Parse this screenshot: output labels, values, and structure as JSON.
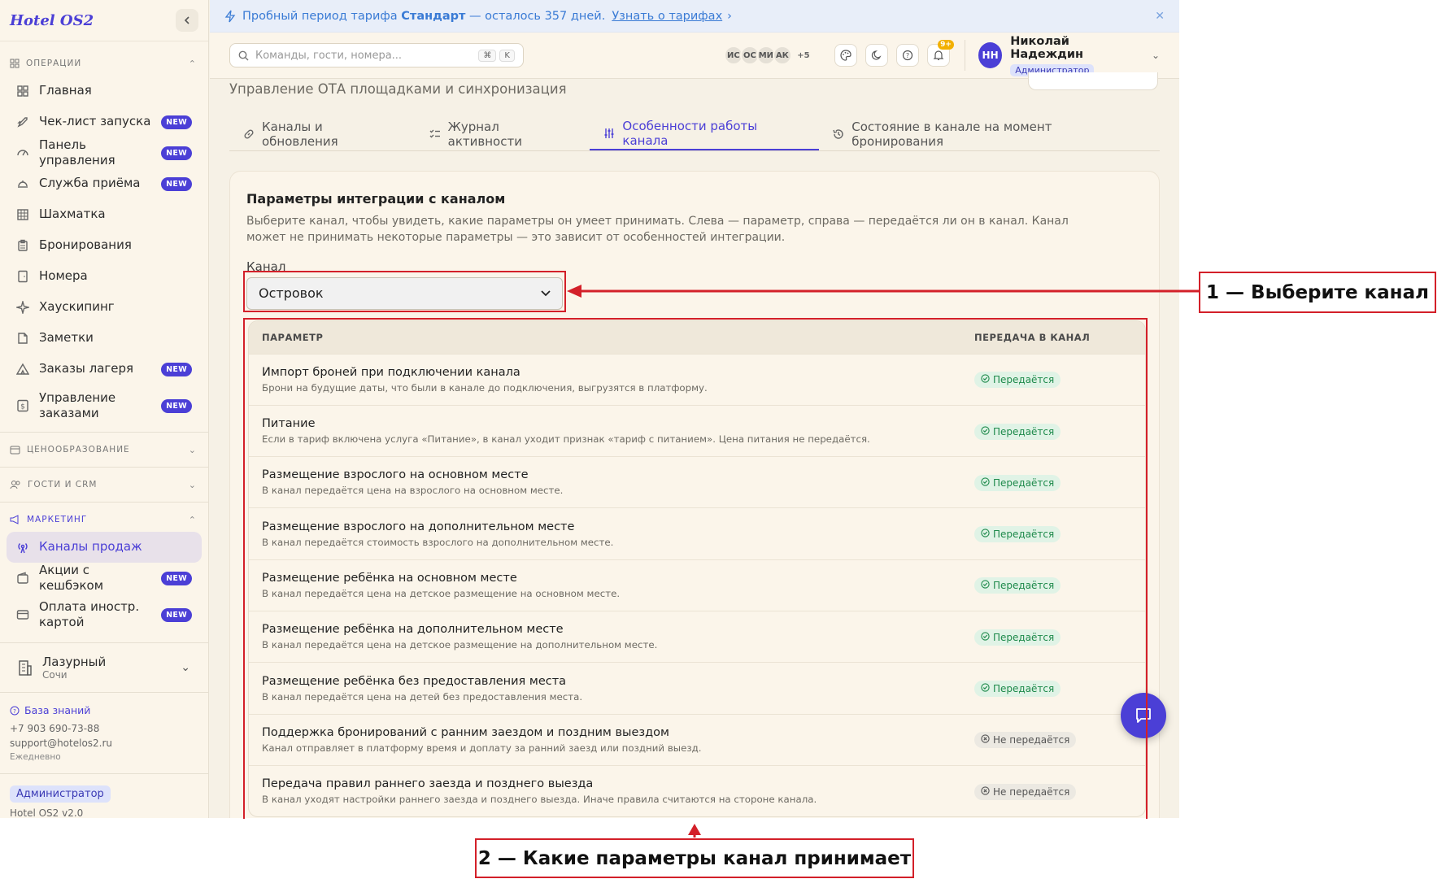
{
  "app": {
    "logo": "Hotel OS2"
  },
  "trial": {
    "prefix": "Пробный период тарифа",
    "plan": "Стандарт",
    "suffix": "— осталось 357 дней.",
    "link": "Узнать о тарифах"
  },
  "search": {
    "placeholder": "Команды, гости, номера...",
    "kbd1": "⌘",
    "kbd2": "K"
  },
  "avatars": [
    "ИС",
    "ОС",
    "МИ",
    "АК",
    "+5"
  ],
  "notifications": {
    "count": "9+"
  },
  "user": {
    "initials": "НН",
    "name": "Николай Надеждин",
    "role": "Администратор"
  },
  "sidebar": {
    "group_ops": "Операции",
    "group_pricing": "Ценообразование",
    "group_guests": "Гости и CRM",
    "group_marketing": "Маркетинг",
    "new_badge": "NEW",
    "items": [
      {
        "label": "Главная",
        "icon": "grid-icon"
      },
      {
        "label": "Чек-лист запуска",
        "icon": "rocket-icon",
        "new": true
      },
      {
        "label": "Панель управления",
        "icon": "gauge-icon",
        "new": true
      },
      {
        "label": "Служба приёма",
        "icon": "bell-service-icon",
        "new": true
      },
      {
        "label": "Шахматка",
        "icon": "table-icon"
      },
      {
        "label": "Бронирования",
        "icon": "clipboard-icon"
      },
      {
        "label": "Номера",
        "icon": "door-icon"
      },
      {
        "label": "Хаускипинг",
        "icon": "sparkle-icon"
      },
      {
        "label": "Заметки",
        "icon": "note-icon"
      },
      {
        "label": "Заказы лагеря",
        "icon": "tent-icon",
        "new": true
      },
      {
        "label": "Управление заказами",
        "icon": "dollar-icon",
        "new": true
      }
    ],
    "marketing_items": [
      {
        "label": "Каналы продаж",
        "icon": "broadcast-icon"
      },
      {
        "label": "Акции с кешбэком",
        "icon": "wallet-icon",
        "new": true
      },
      {
        "label": "Оплата иностр. картой",
        "icon": "card-icon",
        "new": true
      }
    ],
    "hotel": {
      "name": "Лазурный",
      "city": "Сочи"
    },
    "footer": {
      "kb": "База знаний",
      "phone": "+7 903 690-73-88",
      "email": "support@hotelos2.ru",
      "hours": "Ежедневно",
      "role": "Администратор",
      "version": "Hotel OS2 v2.0"
    }
  },
  "page": {
    "subtitle": "Управление ОТА площадками и синхронизация",
    "tabs": [
      {
        "label": "Каналы и обновления",
        "icon": "link-icon"
      },
      {
        "label": "Журнал активности",
        "icon": "list-check-icon"
      },
      {
        "label": "Особенности работы канала",
        "icon": "sliders-icon",
        "active": true
      },
      {
        "label": "Состояние в канале на момент бронирования",
        "icon": "history-icon"
      }
    ]
  },
  "integration": {
    "title": "Параметры интеграции с каналом",
    "description": "Выберите канал, чтобы увидеть, какие параметры он умеет принимать. Слева — параметр, справа — передаётся ли он в канал. Канал может не принимать некоторые параметры — это зависит от особенностей интеграции.",
    "channel_label": "Канал",
    "channel_value": "Островок",
    "col_param": "ПАРАМЕТР",
    "col_transfer": "ПЕРЕДАЧА В КАНАЛ",
    "status_yes": "Передаётся",
    "status_no": "Не передаётся",
    "rows": [
      {
        "title": "Импорт броней при подключении канала",
        "desc": "Брони на будущие даты, что были в канале до подключения, выгрузятся в платформу.",
        "status": "yes"
      },
      {
        "title": "Питание",
        "desc": "Если в тариф включена услуга «Питание», в канал уходит признак «тариф с питанием». Цена питания не передаётся.",
        "status": "yes"
      },
      {
        "title": "Размещение взрослого на основном месте",
        "desc": "В канал передаётся цена на взрослого на основном месте.",
        "status": "yes"
      },
      {
        "title": "Размещение взрослого на дополнительном месте",
        "desc": "В канал передаётся стоимость взрослого на дополнительном месте.",
        "status": "yes"
      },
      {
        "title": "Размещение ребёнка на основном месте",
        "desc": "В канал передаётся цена на детское размещение на основном месте.",
        "status": "yes"
      },
      {
        "title": "Размещение ребёнка на дополнительном месте",
        "desc": "В канал передаётся цена на детское размещение на дополнительном месте.",
        "status": "yes"
      },
      {
        "title": "Размещение ребёнка без предоставления места",
        "desc": "В канал передаётся цена на детей без предоставления места.",
        "status": "yes"
      },
      {
        "title": "Поддержка бронирований с ранним заездом и поздним выездом",
        "desc": "Канал отправляет в платформу время и доплату за ранний заезд или поздний выезд.",
        "status": "no"
      },
      {
        "title": "Передача правил раннего заезда и позднего выезда",
        "desc": "В канал уходят настройки раннего заезда и позднего выезда. Иначе правила считаются на стороне канала.",
        "status": "no"
      }
    ]
  },
  "annotations": {
    "one": "1 — Выберите канал",
    "two": "2 — Какие параметры канал принимает"
  },
  "colors": {
    "accent": "#4b3fd6",
    "annotation": "#d32029",
    "ok": "#1e8a4b"
  }
}
